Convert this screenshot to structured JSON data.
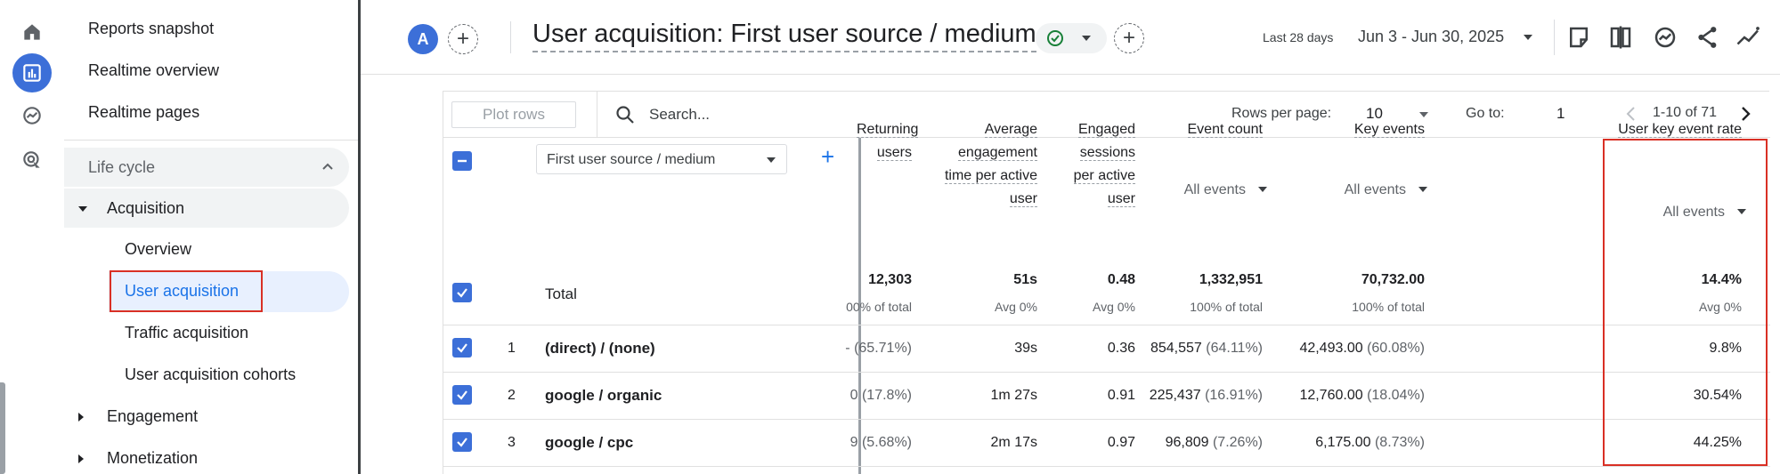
{
  "nav": {
    "items_top": [
      "Reports snapshot",
      "Realtime overview",
      "Realtime pages"
    ],
    "lifecycle": "Life cycle",
    "acquisition": "Acquisition",
    "acquisition_sub": [
      "Overview",
      "User acquisition",
      "Traffic acquisition",
      "User acquisition cohorts"
    ],
    "engagement": "Engagement",
    "monetization": "Monetization"
  },
  "header": {
    "avatar_letter": "A",
    "title": "User acquisition: First user source / medium",
    "date_label": "Last 28 days",
    "date_range": "Jun 3 - Jun 30, 2025"
  },
  "toolbar": {
    "plot_rows": "Plot rows",
    "search_placeholder": "Search...",
    "rows_per_page_label": "Rows per page:",
    "rows_per_page_value": "10",
    "go_to_label": "Go to:",
    "go_to_value": "1",
    "pager": "1-10 of 71"
  },
  "table": {
    "dimension": "First user source / medium",
    "columns": [
      {
        "label": "Returning users",
        "sub": ""
      },
      {
        "label": "Average engagement time per active user",
        "sub": ""
      },
      {
        "label": "Engaged sessions per active user",
        "sub": ""
      },
      {
        "label": "Event count",
        "sub": "All events"
      },
      {
        "label": "Key events",
        "sub": "All events"
      },
      {
        "label": "User key event rate",
        "sub": "All events"
      }
    ],
    "total": {
      "label": "Total",
      "values": [
        "12,303",
        "51s",
        "0.48",
        "1,332,951",
        "70,732.00",
        "14.4%"
      ],
      "subs": [
        "00% of total",
        "Avg 0%",
        "Avg 0%",
        "100% of total",
        "100% of total",
        "Avg 0%"
      ]
    },
    "rows": [
      {
        "num": "1",
        "label": "(direct) / (none)",
        "values": [
          "(65.71%)",
          "39s",
          "0.36",
          "854,557",
          "42,493.00",
          "9.8%"
        ],
        "pcts": [
          "",
          "",
          "",
          "(64.11%)",
          "(60.08%)",
          ""
        ],
        "lead": [
          "-",
          "",
          "",
          "",
          "",
          ""
        ]
      },
      {
        "num": "2",
        "label": "google / organic",
        "values": [
          "(17.8%)",
          "1m 27s",
          "0.91",
          "225,437",
          "12,760.00",
          "30.54%"
        ],
        "pcts": [
          "",
          "",
          "",
          "(16.91%)",
          "(18.04%)",
          ""
        ],
        "lead": [
          "0",
          "",
          "",
          "",
          "",
          ""
        ]
      },
      {
        "num": "3",
        "label": "google / cpc",
        "values": [
          "(5.68%)",
          "2m 17s",
          "0.97",
          "96,809",
          "6,175.00",
          "44.25%"
        ],
        "pcts": [
          "",
          "",
          "",
          "(7.26%)",
          "(8.73%)",
          ""
        ],
        "lead": [
          "9",
          "",
          "",
          "",
          "",
          ""
        ]
      }
    ]
  },
  "colors": {
    "accent": "#3c6fd8",
    "highlight": "#d93025",
    "link": "#1a73e8"
  }
}
